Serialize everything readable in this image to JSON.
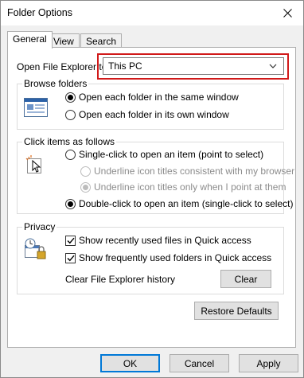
{
  "window": {
    "title": "Folder Options"
  },
  "tabs": [
    {
      "label": "General",
      "active": true
    },
    {
      "label": "View",
      "active": false
    },
    {
      "label": "Search",
      "active": false
    }
  ],
  "open_explorer": {
    "label": "Open File Explorer to:",
    "value": "This PC"
  },
  "browse_folders": {
    "title": "Browse folders",
    "options": [
      {
        "label": "Open each folder in the same window",
        "checked": true
      },
      {
        "label": "Open each folder in its own window",
        "checked": false
      }
    ]
  },
  "click_items": {
    "title": "Click items as follows",
    "single_click": {
      "label": "Single-click to open an item (point to select)",
      "checked": false
    },
    "underline_consistent": {
      "label": "Underline icon titles consistent with my browser",
      "enabled": false
    },
    "underline_point": {
      "label": "Underline icon titles only when I point at them",
      "enabled": false,
      "checked": true
    },
    "double_click": {
      "label": "Double-click to open an item (single-click to select)",
      "checked": true
    }
  },
  "privacy": {
    "title": "Privacy",
    "show_recent_files": {
      "label": "Show recently used files in Quick access",
      "checked": true
    },
    "show_frequent_folders": {
      "label": "Show frequently used folders in Quick access",
      "checked": true
    },
    "clear_history_label": "Clear File Explorer history",
    "clear_button": "Clear"
  },
  "restore_defaults": "Restore Defaults",
  "footer": {
    "ok": "OK",
    "cancel": "Cancel",
    "apply": "Apply"
  },
  "colors": {
    "highlight_border": "#d11a1a",
    "focus_border": "#0078d7"
  }
}
